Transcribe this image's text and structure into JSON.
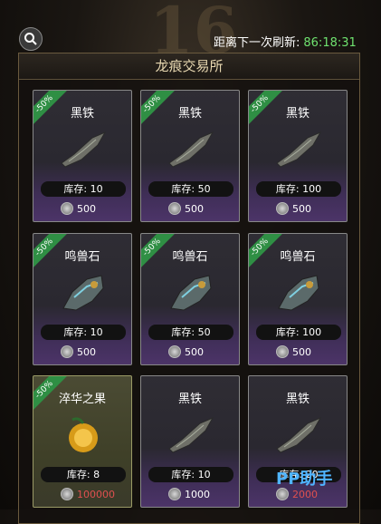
{
  "background_number": "16",
  "header": {
    "refresh_label": "距离下一次刷新:",
    "refresh_time": "86:18:31"
  },
  "panel": {
    "title": "龙痕交易所"
  },
  "items": [
    {
      "name": "黑铁",
      "stock": "库存: 10",
      "price": "500",
      "discount": "-50%",
      "style": "iron"
    },
    {
      "name": "黑铁",
      "stock": "库存: 50",
      "price": "500",
      "discount": "-50%",
      "style": "iron"
    },
    {
      "name": "黑铁",
      "stock": "库存: 100",
      "price": "500",
      "discount": "-50%",
      "style": "iron"
    },
    {
      "name": "鸣兽石",
      "stock": "库存: 10",
      "price": "500",
      "discount": "-50%",
      "style": "stone"
    },
    {
      "name": "鸣兽石",
      "stock": "库存: 50",
      "price": "500",
      "discount": "-50%",
      "style": "stone"
    },
    {
      "name": "鸣兽石",
      "stock": "库存: 100",
      "price": "500",
      "discount": "-50%",
      "style": "stone"
    },
    {
      "name": "淬华之果",
      "stock": "库存: 8",
      "price": "100000",
      "discount": "-50%",
      "style": "fruit"
    },
    {
      "name": "黑铁",
      "stock": "库存: 10",
      "price": "1000",
      "discount": "",
      "style": "iron"
    },
    {
      "name": "黑铁",
      "stock": "库存: 20",
      "price": "2000",
      "discount": "",
      "style": "iron"
    }
  ],
  "watermark": "PP助手"
}
